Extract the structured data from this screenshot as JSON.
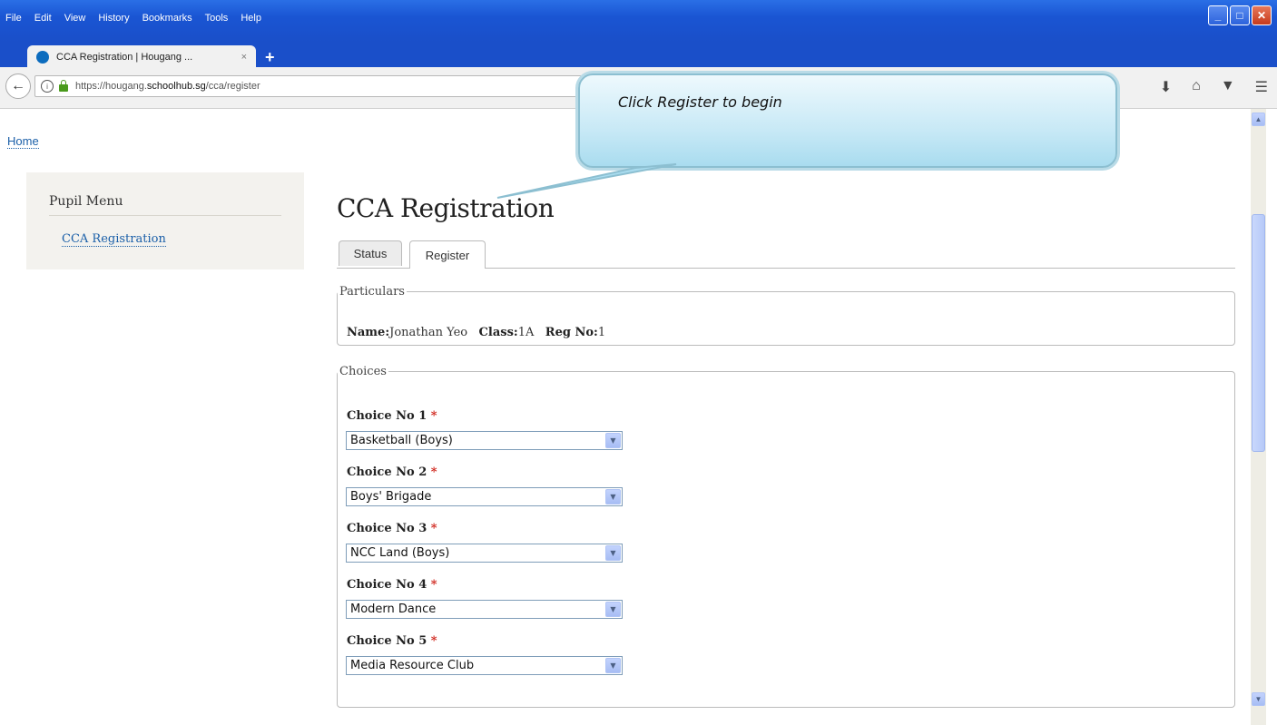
{
  "browser": {
    "menu": [
      "File",
      "Edit",
      "View",
      "History",
      "Bookmarks",
      "Tools",
      "Help"
    ],
    "tab_title": "CCA Registration | Hougang ...",
    "tab_close": "×",
    "new_tab": "+",
    "url_prefix": "https://hougang.",
    "url_host": "schoolhub.sg",
    "url_path": "/cca/register"
  },
  "breadcrumb": {
    "home": "Home"
  },
  "sidebar": {
    "title": "Pupil Menu",
    "item": "CCA Registration"
  },
  "page": {
    "title": "CCA Registration",
    "tabs": [
      "Status",
      "Register"
    ],
    "particulars": {
      "legend": "Particulars",
      "name_label": "Name:",
      "name_value": "Jonathan Yeo",
      "class_label": "Class:",
      "class_value": "1A",
      "reg_label": "Reg No:",
      "reg_value": "1"
    },
    "choices": {
      "legend": "Choices",
      "items": [
        {
          "label": "Choice No 1",
          "value": "Basketball (Boys)"
        },
        {
          "label": "Choice No 2",
          "value": "Boys' Brigade"
        },
        {
          "label": "Choice No 3",
          "value": "NCC Land (Boys)"
        },
        {
          "label": "Choice No 4",
          "value": "Modern Dance"
        },
        {
          "label": "Choice No 5",
          "value": "Media Resource Club"
        }
      ],
      "required_mark": "*"
    }
  },
  "annotation": {
    "text": "Click Register to begin"
  }
}
